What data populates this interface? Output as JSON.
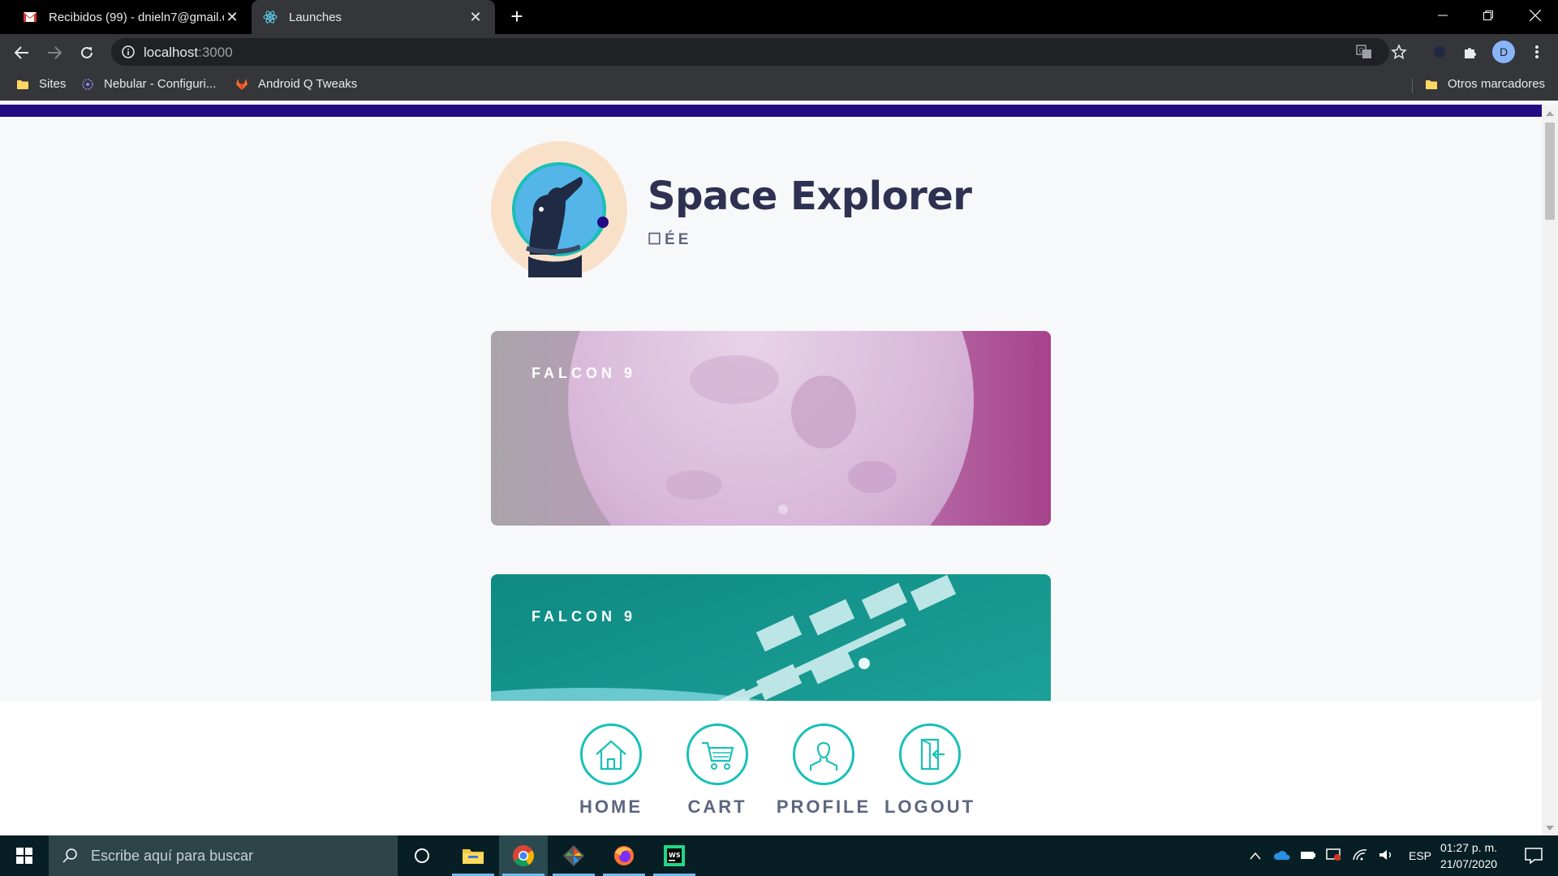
{
  "browser": {
    "tabs": [
      {
        "title": "Recibidos (99) - dnieln7@gmail.c",
        "icon": "gmail-icon",
        "active": false
      },
      {
        "title": "Launches",
        "icon": "react-icon",
        "active": true
      }
    ],
    "url_host": "localhost",
    "url_port": ":3000",
    "bookmarks": [
      {
        "label": "Sites",
        "icon": "folder-icon"
      },
      {
        "label": "Nebular - Configuri...",
        "icon": "nebular-icon"
      },
      {
        "label": "Android Q Tweaks",
        "icon": "gitlab-icon"
      }
    ],
    "other_bookmarks": "Otros marcadores",
    "profile_initial": "D"
  },
  "app": {
    "title": "Space Explorer",
    "subtitle": "☐ÉE",
    "launches": [
      {
        "rocket": "FALCON 9",
        "image": "moon"
      },
      {
        "rocket": "FALCON 9",
        "image": "space-station"
      }
    ],
    "nav": [
      {
        "label": "HOME",
        "icon": "home-icon"
      },
      {
        "label": "CART",
        "icon": "cart-icon"
      },
      {
        "label": "PROFILE",
        "icon": "profile-icon"
      },
      {
        "label": "LOGOUT",
        "icon": "logout-icon"
      }
    ],
    "colors": {
      "accent": "#19c0b8",
      "top_bar": "#220a82",
      "title": "#2e3151",
      "label": "#5d6680"
    }
  },
  "taskbar": {
    "search_placeholder": "Escribe aquí para buscar",
    "language": "ESP",
    "time": "01:27 p. m.",
    "date": "21/07/2020"
  }
}
